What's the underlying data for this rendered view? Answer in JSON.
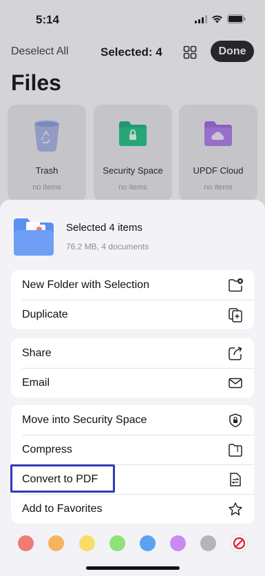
{
  "status": {
    "time": "5:14"
  },
  "toolbar": {
    "deselect_label": "Deselect All",
    "selected_label": "Selected: 4",
    "done_label": "Done"
  },
  "page": {
    "title": "Files"
  },
  "folders": [
    {
      "name": "Trash",
      "sub": "no items",
      "icon": "trash-icon",
      "color": "#a9b7e8"
    },
    {
      "name": "Security Space",
      "sub": "no items",
      "icon": "lock-folder-icon",
      "color": "#1db37a"
    },
    {
      "name": "UPDF Cloud",
      "sub": "no items",
      "icon": "cloud-folder-icon",
      "color": "#a26be6"
    }
  ],
  "sheet": {
    "title": "Selected 4 items",
    "subtitle": "76.2 MB, 4 documents",
    "groups": [
      [
        {
          "label": "New Folder with Selection",
          "icon": "new-folder-icon"
        },
        {
          "label": "Duplicate",
          "icon": "duplicate-icon"
        }
      ],
      [
        {
          "label": "Share",
          "icon": "share-icon"
        },
        {
          "label": "Email",
          "icon": "envelope-icon"
        }
      ],
      [
        {
          "label": "Move into Security Space",
          "icon": "shield-lock-icon"
        },
        {
          "label": "Compress",
          "icon": "zip-folder-icon"
        },
        {
          "label": "Convert to PDF",
          "icon": "convert-doc-icon"
        },
        {
          "label": "Add to Favorites",
          "icon": "star-icon"
        }
      ]
    ]
  },
  "tag_colors": [
    "#f07b73",
    "#f4b35e",
    "#f7dd66",
    "#8ee27a",
    "#5aa2f2",
    "#c98af3",
    "#b5b5b8"
  ],
  "colors": {
    "highlight": "#2f3ab8",
    "accent_done": "#222222",
    "clear_tag": "#e0243b"
  }
}
